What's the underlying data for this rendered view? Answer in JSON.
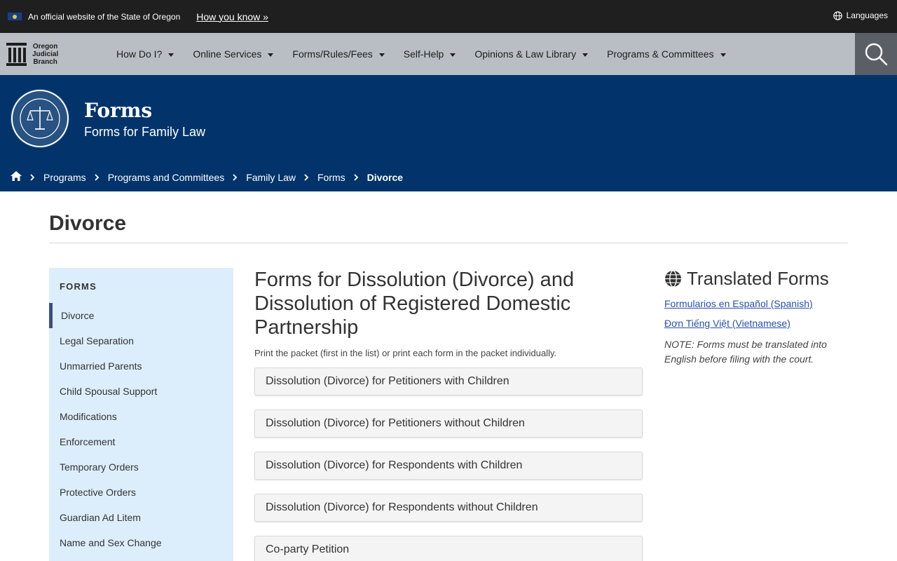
{
  "official_bar": {
    "text": "An official website of the State of Oregon",
    "how_you_know": "How you know »",
    "languages": "Languages"
  },
  "logo": {
    "line1": "Oregon",
    "line2": "Judicial",
    "line3": "Branch"
  },
  "nav": {
    "items": [
      {
        "label": "How Do I?"
      },
      {
        "label": "Online Services"
      },
      {
        "label": "Forms/Rules/Fees"
      },
      {
        "label": "Self-Help"
      },
      {
        "label": "Opinions & Law Library"
      },
      {
        "label": "Programs & Committees"
      }
    ]
  },
  "banner": {
    "title": "Forms",
    "subtitle": "Forms for Family Law"
  },
  "breadcrumb": [
    {
      "label": "Programs"
    },
    {
      "label": "Programs and Committees"
    },
    {
      "label": "Family Law"
    },
    {
      "label": "Forms"
    },
    {
      "label": "Divorce"
    }
  ],
  "page_title": "Divorce",
  "sidenav": {
    "title": "FORMS",
    "items": [
      {
        "label": "Divorce"
      },
      {
        "label": "Legal Separation"
      },
      {
        "label": "Unmarried Parents"
      },
      {
        "label": "Child Spousal Support"
      },
      {
        "label": "Modifications"
      },
      {
        "label": "Enforcement"
      },
      {
        "label": "Temporary Orders"
      },
      {
        "label": "Protective Orders"
      },
      {
        "label": "Guardian Ad Litem"
      },
      {
        "label": "Name and Sex Change"
      }
    ]
  },
  "main": {
    "title": "Forms for Dissolution (Divorce) and Dissolution of Registered Domestic Partnership",
    "intro": "Print the packet (first in the list) or print each form in the packet individually.",
    "accordion": [
      {
        "label": "Dissolution (Divorce) for Petitioners with Children"
      },
      {
        "label": "Dissolution (Divorce) for Petitioners without Children"
      },
      {
        "label": "Dissolution (Divorce) for Respondents with Children"
      },
      {
        "label": "Dissolution (Divorce) for Respondents without Children"
      },
      {
        "label": "Co-party Petition"
      }
    ]
  },
  "aside": {
    "title": "Translated Forms",
    "link_spanish": "Formularios en Español (Spanish)",
    "link_vietnamese": "Đơn Tiếng Việt (Vietnamese)",
    "note": "NOTE: Forms must be translated into English before filing with the court."
  },
  "colors": {
    "top_bar": "#1f1f1f",
    "nav_bar": "#b9bec4",
    "banner": "#02346b",
    "sidenav_bg": "#dceefc",
    "active_marker": "#3d4f80",
    "link": "#2a4fad"
  },
  "icons": {
    "flag": "oregon-flag-icon",
    "languages": "globe-icon",
    "search": "search-icon",
    "home": "home-icon",
    "separator": "chevron-right-icon",
    "translated": "globe-icon"
  }
}
